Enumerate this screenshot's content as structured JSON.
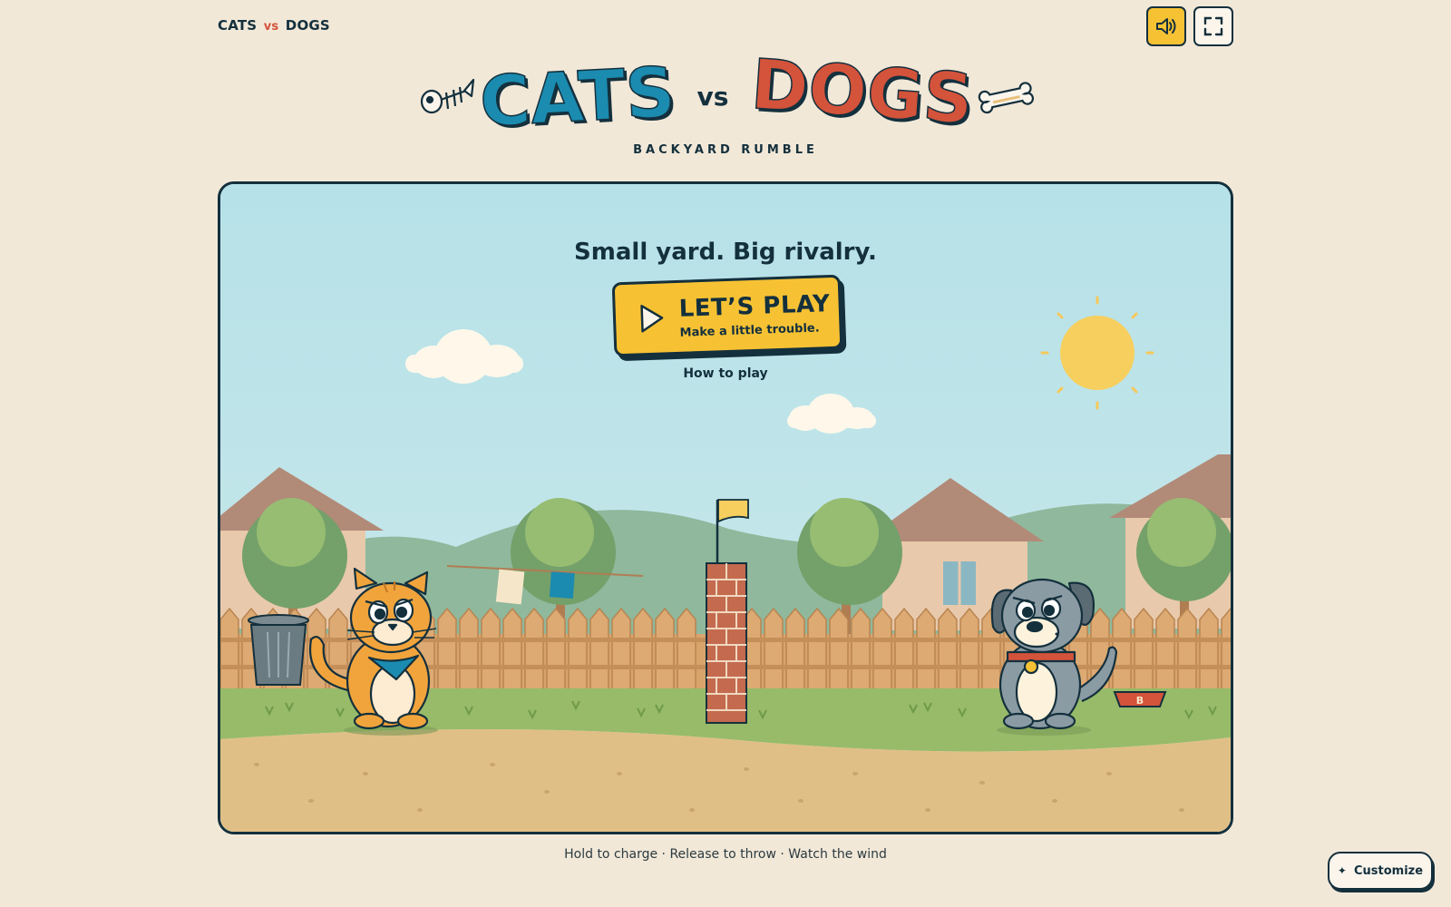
{
  "brand": {
    "left": "CATS",
    "vs": "vs",
    "right": "DOGS"
  },
  "toolbar": {
    "sound_icon": "speaker-icon",
    "fullscreen_icon": "fullscreen-icon"
  },
  "logo": {
    "left": "CATS",
    "vs": "vs",
    "right": "DOGS",
    "left_color": "#1b8bb0",
    "right_color": "#d4533b"
  },
  "subtitle": "BACKYARD RUMBLE",
  "stage": {
    "tagline": "Small yard. Big rivalry.",
    "play": {
      "title": "LET’S PLAY",
      "subtitle": "Make a little trouble."
    },
    "how_to": "How to play",
    "bowl_label": "B"
  },
  "footer": {
    "hint": "Hold to charge · Release to throw · Watch the wind"
  },
  "customize": {
    "label": "Customize",
    "icon": "sparkle-icon"
  },
  "colors": {
    "accent": "#f6c234",
    "ink": "#14303d",
    "background": "#f2e8d8"
  }
}
